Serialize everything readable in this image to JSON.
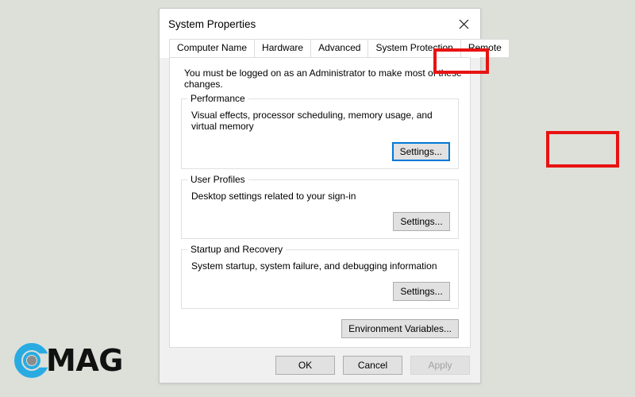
{
  "watermark": {
    "brand_text": "MAG",
    "mark_color": "#29abe2",
    "dot_color": "#8c8c8c"
  },
  "dialog": {
    "title": "System Properties",
    "close_icon": "close-icon",
    "tabs": [
      {
        "label": "Computer Name",
        "active": false
      },
      {
        "label": "Hardware",
        "active": false
      },
      {
        "label": "Advanced",
        "active": true
      },
      {
        "label": "System Protection",
        "active": false
      },
      {
        "label": "Remote",
        "active": false
      }
    ],
    "admin_note": "You must be logged on as an Administrator to make most of these changes.",
    "groups": [
      {
        "legend": "Performance",
        "description": "Visual effects, processor scheduling, memory usage, and virtual memory",
        "button_label": "Settings...",
        "button_state": "focused"
      },
      {
        "legend": "User Profiles",
        "description": "Desktop settings related to your sign-in",
        "button_label": "Settings...",
        "button_state": "normal"
      },
      {
        "legend": "Startup and Recovery",
        "description": "System startup, system failure, and debugging information",
        "button_label": "Settings...",
        "button_state": "normal"
      }
    ],
    "environment_variables_label": "Environment Variables...",
    "footer": {
      "ok_label": "OK",
      "cancel_label": "Cancel",
      "apply_label": "Apply",
      "apply_disabled": true
    }
  },
  "annotations": {
    "highlight_color": "#e81313",
    "focus_color": "#0078d7",
    "boxes": [
      {
        "target": "advanced-tab"
      },
      {
        "target": "performance-settings-button"
      }
    ]
  }
}
